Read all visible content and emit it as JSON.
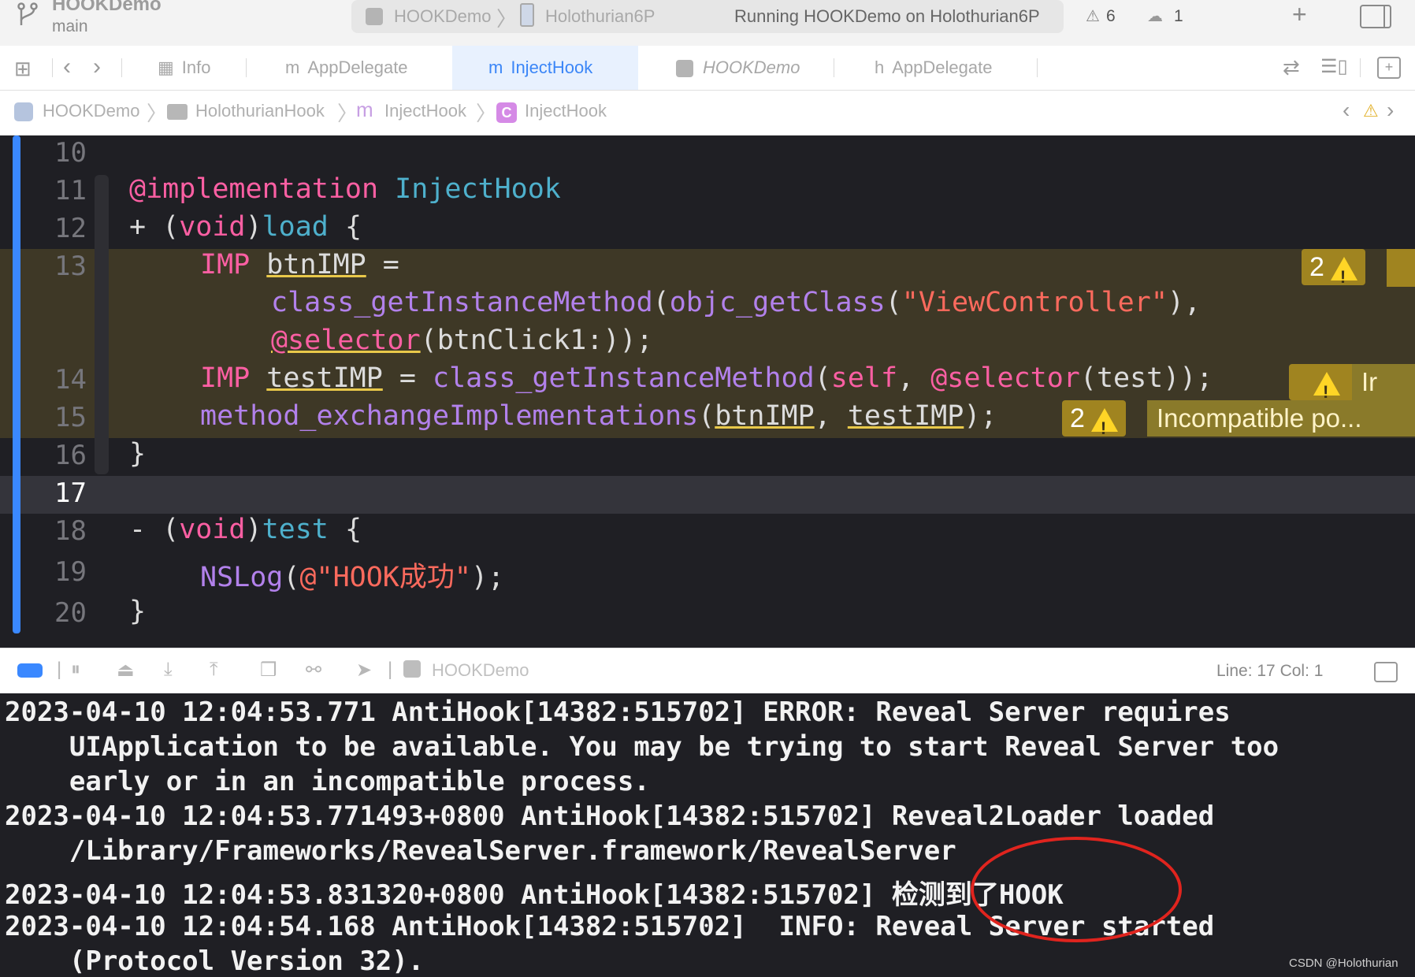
{
  "titlebar": {
    "project": "HOOKDemo",
    "branch": "main",
    "scheme": "HOOKDemo",
    "scheme_sep": "〉",
    "device": "Holothurian6P",
    "status": "Running HOOKDemo on Holothurian6P",
    "warnings": "6",
    "issues": "1",
    "add_icon": "+"
  },
  "tabs": [
    {
      "icon": "table",
      "icon_glyph": "▦",
      "label": "Info"
    },
    {
      "icon": "m",
      "icon_glyph": "m",
      "label": "AppDelegate"
    },
    {
      "icon": "m",
      "icon_glyph": "m",
      "label": "InjectHook"
    },
    {
      "icon": "app",
      "icon_glyph": "",
      "label": "HOOKDemo"
    },
    {
      "icon": "h",
      "icon_glyph": "h",
      "label": "AppDelegate"
    }
  ],
  "jumpbar": {
    "items": [
      "HOOKDemo",
      "HolothurianHook",
      "InjectHook",
      "InjectHook"
    ],
    "sep": "〉",
    "c_icon": "C",
    "m_icon": "m"
  },
  "editor": {
    "line_numbers": [
      "10",
      "11",
      "12",
      "13",
      "14",
      "15",
      "16",
      "17",
      "18",
      "19",
      "20"
    ],
    "lines": {
      "l11_a": "@implementation",
      "l11_b": "InjectHook",
      "l12_a": "+ (",
      "l12_b": "void",
      "l12_c": ")",
      "l12_d": "load",
      "l12_e": " {",
      "l13_a": "IMP",
      "l13_b": "btnIMP",
      "l13_c": " =",
      "l13b_a": "class_getInstanceMethod",
      "l13b_b": "(",
      "l13b_c": "objc_getClass",
      "l13b_d": "(",
      "l13b_e": "\"ViewController\"",
      "l13b_f": "),",
      "l13c_a": "@selector",
      "l13c_b": "(btnClick1:));",
      "l14_a": "IMP",
      "l14_b": "testIMP",
      "l14_c": " = ",
      "l14_d": "class_getInstanceMethod",
      "l14_e": "(",
      "l14_f": "self",
      "l14_g": ", ",
      "l14_h": "@selector",
      "l14_i": "(test));",
      "l15_a": "method_exchangeImplementations",
      "l15_b": "(",
      "l15_c": "btnIMP",
      "l15_d": ", ",
      "l15_e": "testIMP",
      "l15_f": ");",
      "l16": "}",
      "l18_a": "- (",
      "l18_b": "void",
      "l18_c": ")",
      "l18_d": "test",
      "l18_e": " {",
      "l19_a": "NSLog",
      "l19_b": "(",
      "l19_c": "@\"HOOK成功\"",
      "l19_d": ");",
      "l20": "}"
    },
    "warnings": {
      "line13_count": "2",
      "line14_msg": "Ir",
      "line15_count": "2",
      "line15_msg": "Incompatible po..."
    }
  },
  "debugbar": {
    "target": "HOOKDemo",
    "position": "Line: 17  Col: 1"
  },
  "console": {
    "lines": [
      "2023-04-10 12:04:53.771 AntiHook[14382:515702] ERROR: Reveal Server requires",
      "    UIApplication to be available. You may be trying to start Reveal Server too",
      "    early or in an incompatible process.",
      "2023-04-10 12:04:53.771493+0800 AntiHook[14382:515702] Reveal2Loader loaded",
      "    /Library/Frameworks/RevealServer.framework/RevealServer",
      "2023-04-10 12:04:53.831320+0800 AntiHook[14382:515702] 检测到了HOOK",
      "2023-04-10 12:04:54.168 AntiHook[14382:515702]  INFO: Reveal Server started",
      "    (Protocol Version 32)."
    ]
  },
  "watermark": "CSDN @Holothurian",
  "colors": {
    "accent": "#3a88ff",
    "editor_bg": "#1f1f24",
    "keyword": "#fc5fa3",
    "function": "#b281eb",
    "string": "#fc6a5d",
    "warning_bg": "#3e3826",
    "annotation": "#e0241e"
  }
}
